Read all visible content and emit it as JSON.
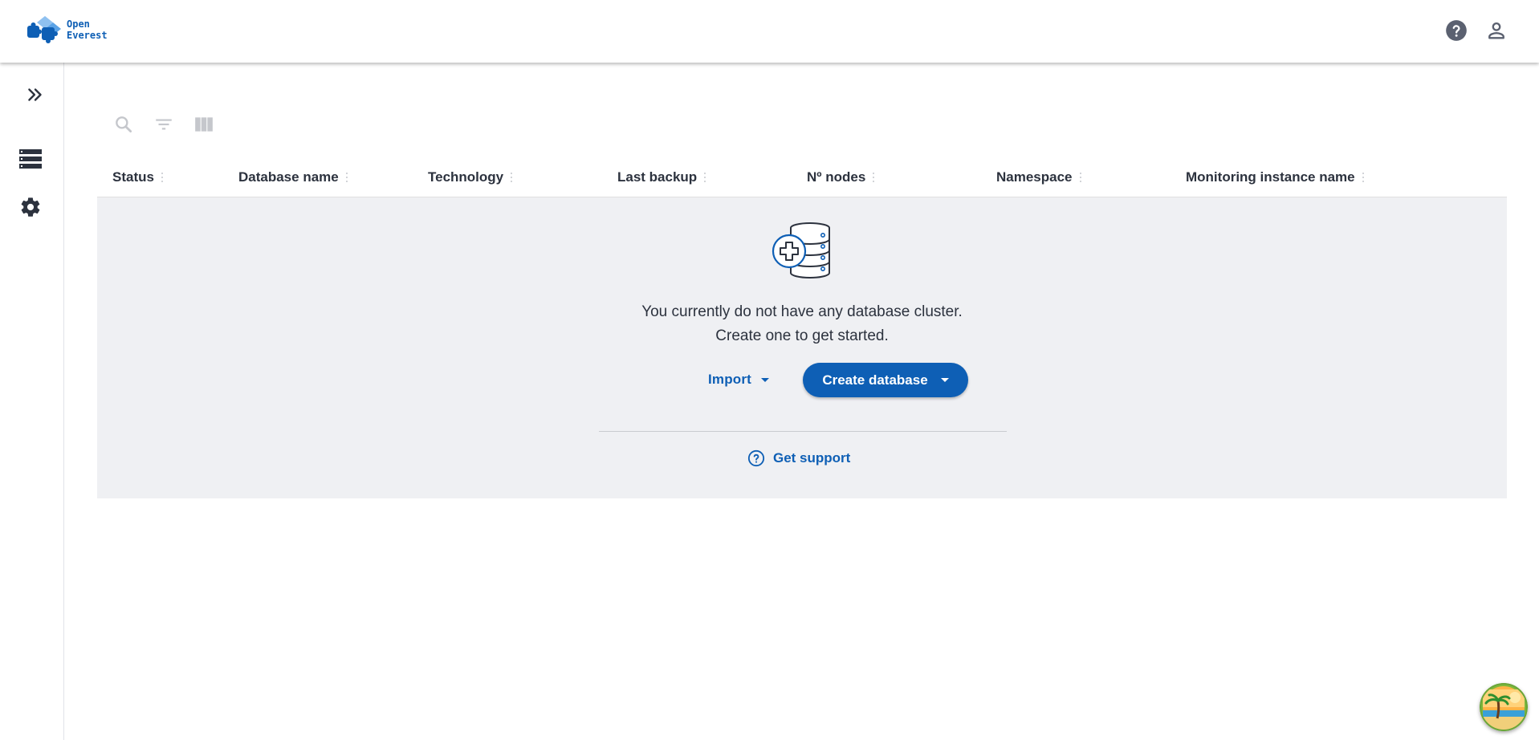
{
  "brand": {
    "line1": "Open",
    "line2": "Everest"
  },
  "topbar": {
    "help_icon": "help-circle-icon",
    "user_icon": "user-account-icon"
  },
  "sidebar": {
    "items": [
      {
        "name": "expand",
        "icon": "double-chevron-right-icon"
      },
      {
        "name": "databases",
        "icon": "database-list-icon"
      },
      {
        "name": "settings",
        "icon": "gear-icon"
      }
    ]
  },
  "toolbar": {
    "icons": [
      "search-icon",
      "filter-icon",
      "columns-icon"
    ]
  },
  "table": {
    "columns": [
      "Status",
      "Database name",
      "Technology",
      "Last backup",
      "Nº nodes",
      "Namespace",
      "Monitoring instance name"
    ]
  },
  "empty_state": {
    "line1": "You currently do not have any database cluster.",
    "line2": "Create one to get started.",
    "import_label": "Import",
    "create_label": "Create database",
    "support_label": "Get support"
  },
  "colors": {
    "primary": "#0e5fb5",
    "panel_bg": "#eff0f3",
    "text": "#2c323e",
    "icon_gray": "#c5c7cc"
  }
}
